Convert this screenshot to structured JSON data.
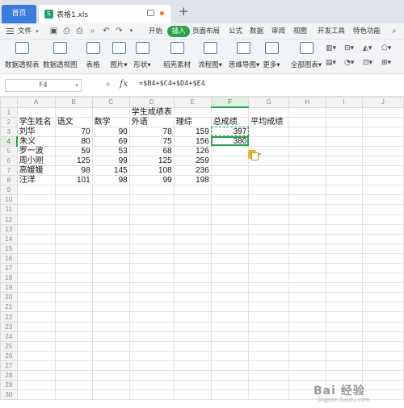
{
  "titlebar": {
    "home_tab": "首页",
    "file_tab": "表格1.xls"
  },
  "menu": {
    "file": "文件",
    "tabs": [
      "开始",
      "插入",
      "页面布局",
      "公式",
      "数据",
      "审阅",
      "视图",
      "开发工具",
      "特色功能"
    ],
    "active_tab": "插入"
  },
  "ribbon": {
    "buttons": [
      "数据透视表",
      "数据透视图",
      "表格",
      "图片",
      "形状",
      "稻壳素材",
      "流程图",
      "思维导图",
      "更多",
      "全部图表"
    ]
  },
  "formula_bar": {
    "name_box": "F4",
    "fx": "fx",
    "formula": "=$B4+$C4+$D4+$E4"
  },
  "columns": [
    "A",
    "B",
    "C",
    "D",
    "E",
    "F",
    "G",
    "H",
    "I",
    "J"
  ],
  "sheet": {
    "title": "学生成绩表",
    "headers": [
      "学生姓名",
      "语文",
      "数学",
      "外语",
      "理综",
      "总成绩",
      "平均成绩"
    ],
    "rows": [
      [
        "刘华",
        "70",
        "90",
        "78",
        "159",
        "397"
      ],
      [
        "朱义",
        "80",
        "69",
        "75",
        "156",
        "380"
      ],
      [
        "罗一波",
        "59",
        "53",
        "68",
        "126",
        ""
      ],
      [
        "周小刚",
        "125",
        "99",
        "125",
        "259",
        ""
      ],
      [
        "高媛媛",
        "98",
        "145",
        "108",
        "236",
        ""
      ],
      [
        "汪洋",
        "101",
        "98",
        "99",
        "198",
        ""
      ]
    ],
    "row_count": 30
  },
  "watermark": {
    "main": "Bai 经验",
    "sub": "jingyan.baidu.com"
  }
}
